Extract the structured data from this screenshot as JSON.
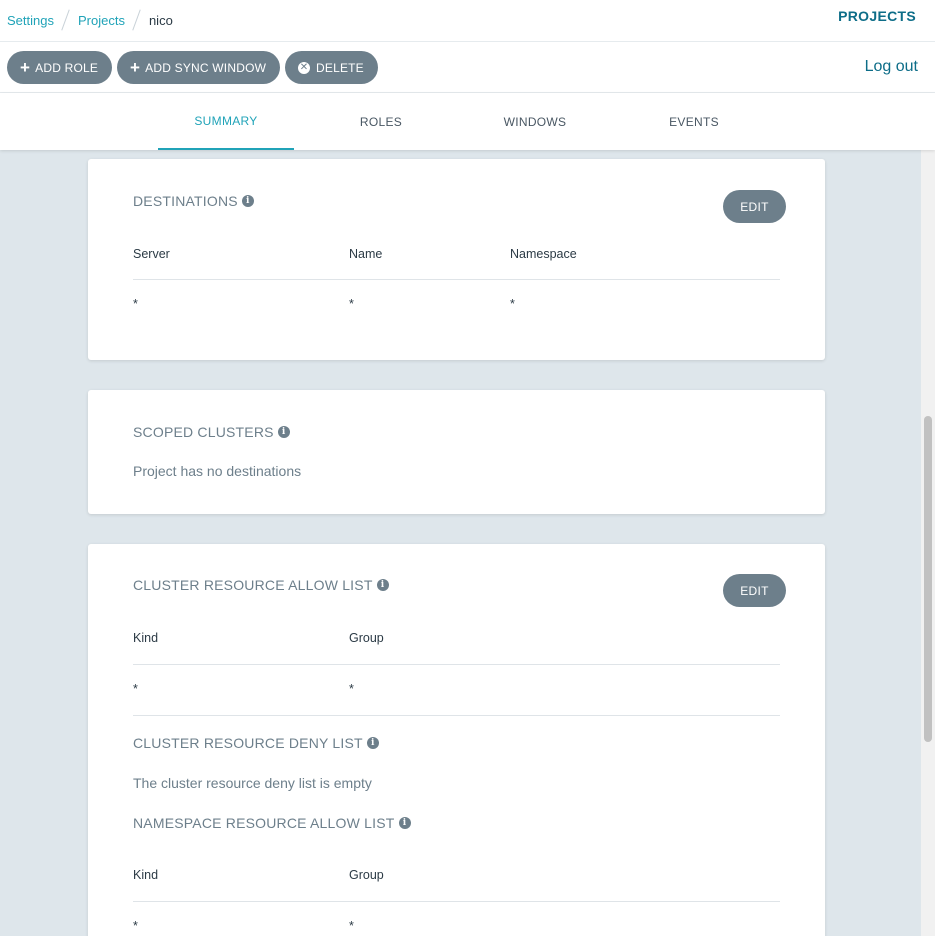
{
  "breadcrumb": [
    "Settings",
    "Projects",
    "nico"
  ],
  "header_title": "PROJECTS",
  "toolbar": {
    "add_role": "ADD ROLE",
    "add_sync_window": "ADD SYNC WINDOW",
    "delete": "DELETE",
    "logout": "Log out"
  },
  "tabs": [
    "SUMMARY",
    "ROLES",
    "WINDOWS",
    "EVENTS"
  ],
  "active_tab": "SUMMARY",
  "destinations": {
    "title": "DESTINATIONS",
    "edit": "EDIT",
    "columns": [
      "Server",
      "Name",
      "Namespace"
    ],
    "rows": [
      [
        "*",
        "*",
        "*"
      ]
    ]
  },
  "scoped_clusters": {
    "title": "SCOPED CLUSTERS",
    "message": "Project has no destinations"
  },
  "cluster_allow": {
    "title": "CLUSTER RESOURCE ALLOW LIST",
    "edit": "EDIT",
    "columns": [
      "Kind",
      "Group"
    ],
    "rows": [
      [
        "*",
        "*"
      ]
    ]
  },
  "cluster_deny": {
    "title": "CLUSTER RESOURCE DENY LIST",
    "message": "The cluster resource deny list is empty"
  },
  "namespace_allow": {
    "title": "NAMESPACE RESOURCE ALLOW LIST",
    "columns": [
      "Kind",
      "Group"
    ],
    "rows": [
      [
        "*",
        "*"
      ]
    ]
  },
  "colors": {
    "accent": "#20a3b8",
    "brand": "#0d6d88",
    "button": "#6d7f8b",
    "background": "#dee6eb"
  }
}
